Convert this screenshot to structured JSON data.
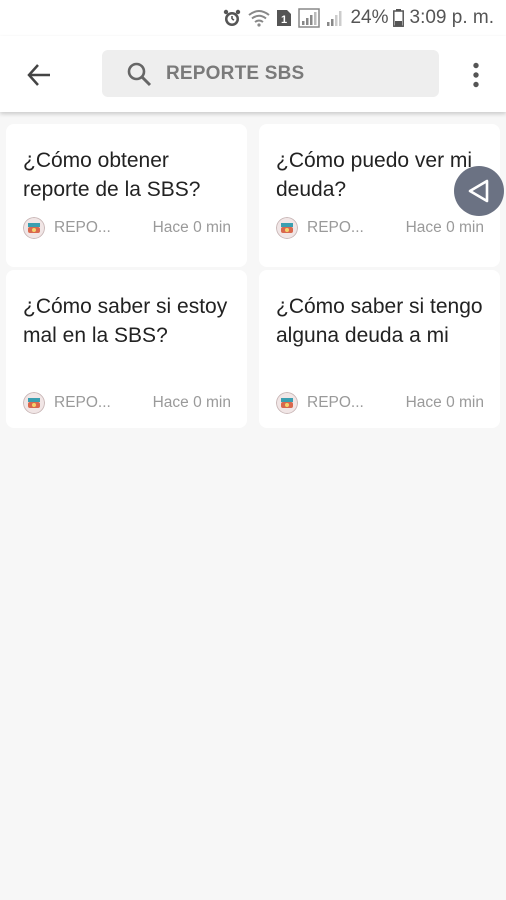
{
  "status_bar": {
    "battery_percent": "24%",
    "time": "3:09 p. m.",
    "sim_badge": "1",
    "icons": [
      "alarm-icon",
      "wifi-icon",
      "sim-icon",
      "signal-icon",
      "signal-icon",
      "battery-icon"
    ]
  },
  "header": {
    "back_icon": "arrow-left-icon",
    "search_icon": "search-icon",
    "search_text": "REPORTE SBS",
    "more_icon": "more-vert-icon"
  },
  "cards": [
    {
      "title": "¿Cómo obtener reporte de la SBS?",
      "source": "REPO...",
      "time": "Hace 0 min"
    },
    {
      "title": "¿Cómo puedo ver mi deuda?",
      "source": "REPO...",
      "time": "Hace 0 min"
    },
    {
      "title": "¿Cómo saber si estoy mal en la SBS?",
      "source": "REPO...",
      "time": "Hace 0 min"
    },
    {
      "title": "¿Cómo saber si tengo alguna deuda a mi",
      "source": "REPO...",
      "time": "Hace 0 min"
    }
  ],
  "floating_button": {
    "icon": "triangle-left-icon"
  },
  "colors": {
    "background": "#f7f7f7",
    "card": "#ffffff",
    "search_bg": "#eeeeee",
    "muted_text": "#9a9a9a",
    "float_button": "#6b7283"
  }
}
